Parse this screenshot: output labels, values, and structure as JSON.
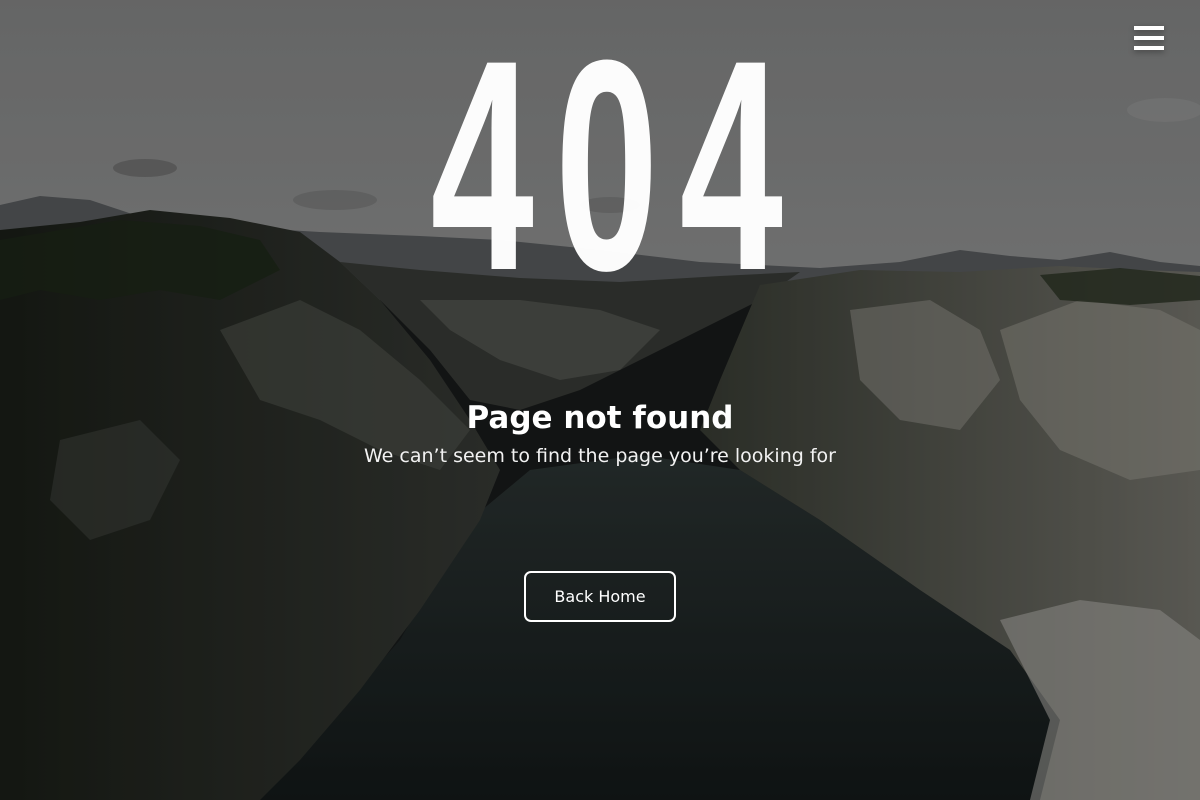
{
  "hero": {
    "error_code": "404",
    "title": "Page not found",
    "subtitle": "We can’t seem to find the page you’re looking for"
  },
  "actions": {
    "back_home_label": "Back Home"
  },
  "header": {
    "menu_icon": "hamburger-menu-icon"
  },
  "colors": {
    "text": "#ffffff",
    "sky": "#8a8b8b",
    "water": "#1b2322"
  }
}
